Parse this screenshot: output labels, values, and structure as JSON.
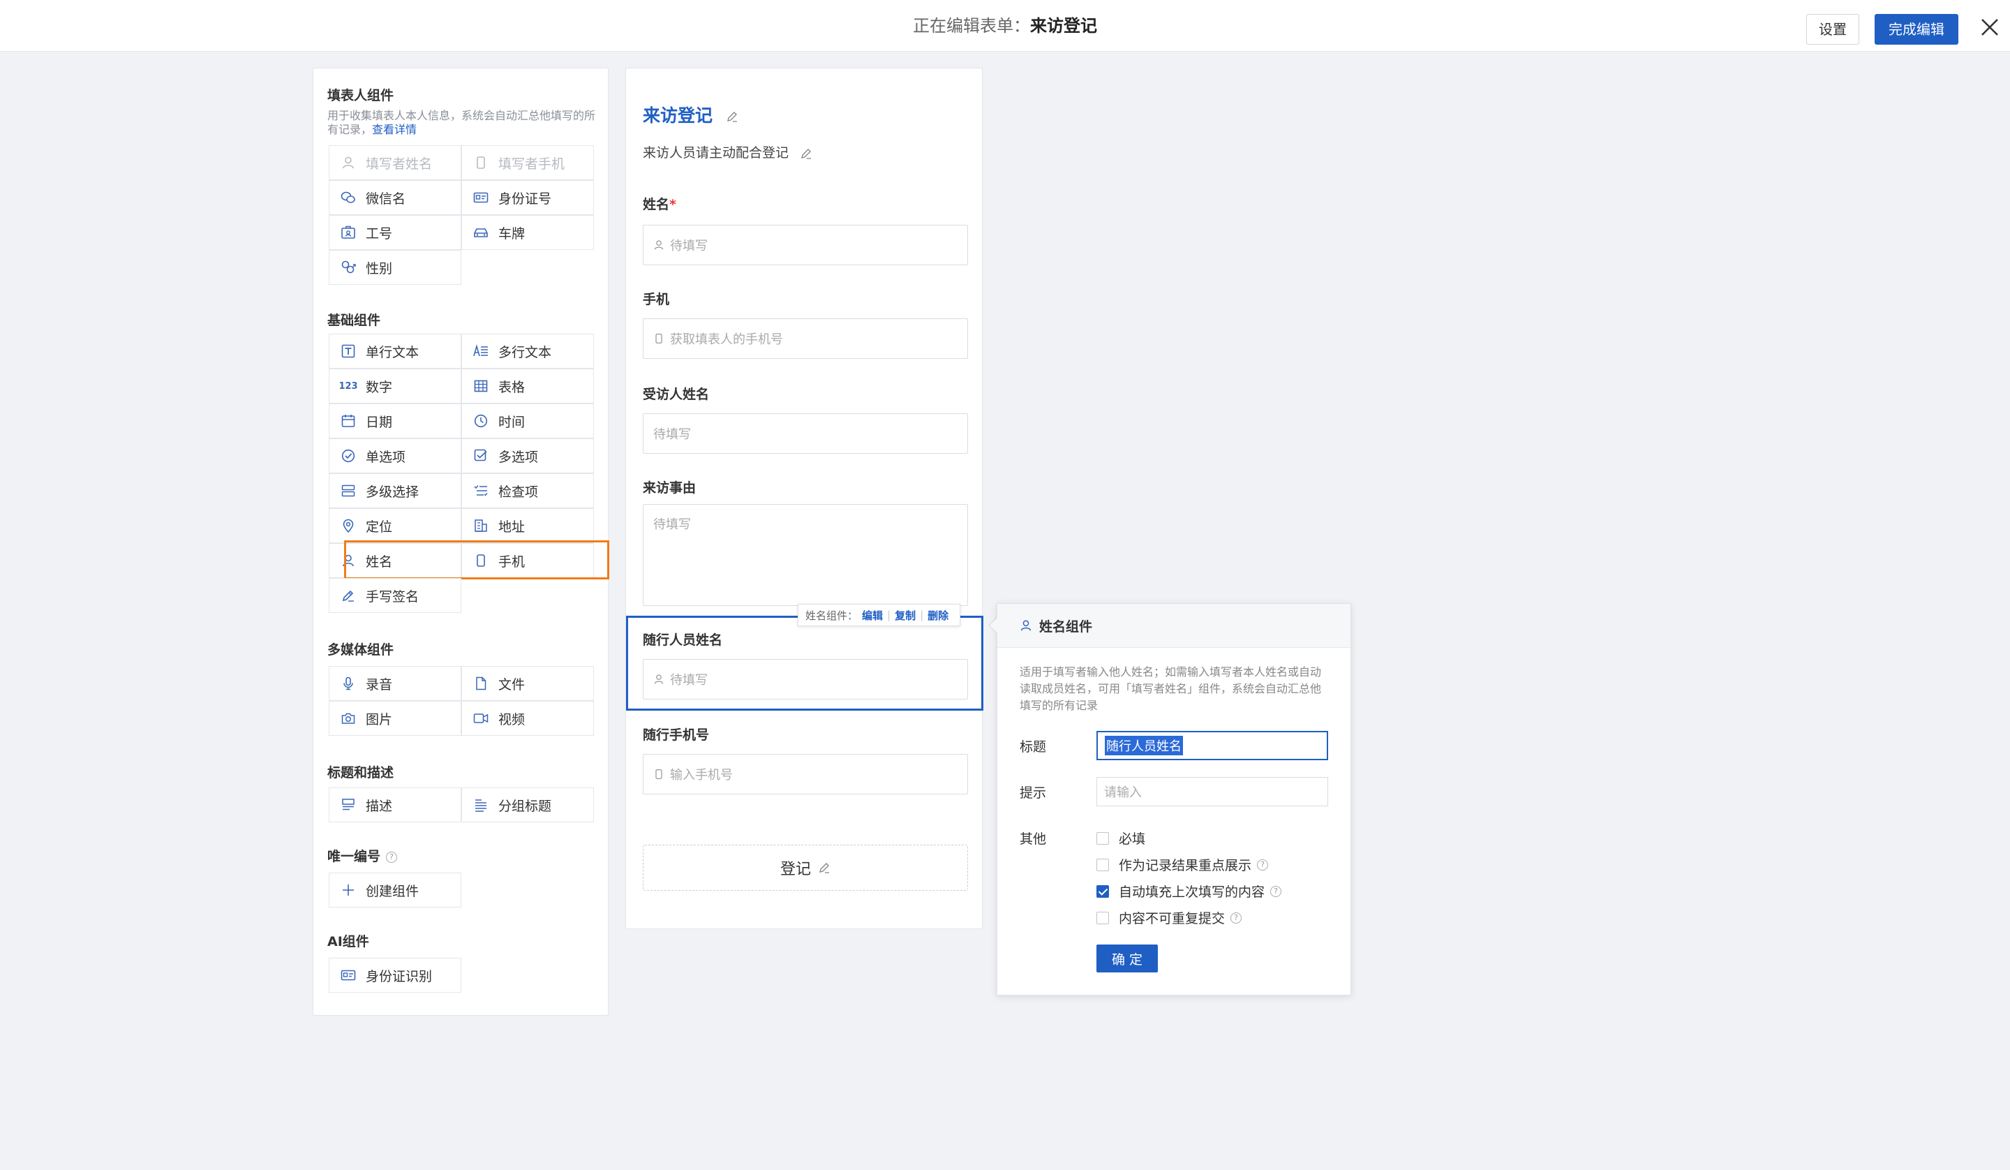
{
  "header": {
    "title_prefix": "正在编辑表单：",
    "title_name": "来访登记",
    "settings_label": "设置",
    "finish_label": "完成编辑"
  },
  "palette": {
    "filler_section": {
      "title": "填表人组件",
      "desc": "用于收集填表人本人信息，系统会自动汇总他填写的所有记录，",
      "desc_link": "查看详情",
      "items": [
        {
          "label": "填写者姓名",
          "icon": "user-icon",
          "disabled": true
        },
        {
          "label": "填写者手机",
          "icon": "phone-icon",
          "disabled": true
        },
        {
          "label": "微信名",
          "icon": "wechat-icon"
        },
        {
          "label": "身份证号",
          "icon": "id-card-icon"
        },
        {
          "label": "工号",
          "icon": "badge-icon"
        },
        {
          "label": "车牌",
          "icon": "car-icon"
        },
        {
          "label": "性别",
          "icon": "gender-icon"
        }
      ]
    },
    "basic_section": {
      "title": "基础组件",
      "items": [
        {
          "label": "单行文本",
          "icon": "text-icon"
        },
        {
          "label": "多行文本",
          "icon": "multiline-text-icon"
        },
        {
          "label": "数字",
          "icon": "number-icon"
        },
        {
          "label": "表格",
          "icon": "table-icon"
        },
        {
          "label": "日期",
          "icon": "calendar-icon"
        },
        {
          "label": "时间",
          "icon": "clock-icon"
        },
        {
          "label": "单选项",
          "icon": "radio-icon"
        },
        {
          "label": "多选项",
          "icon": "checkbox-icon"
        },
        {
          "label": "多级选择",
          "icon": "cascade-icon"
        },
        {
          "label": "检查项",
          "icon": "checklist-icon"
        },
        {
          "label": "定位",
          "icon": "location-icon"
        },
        {
          "label": "地址",
          "icon": "address-icon"
        },
        {
          "label": "姓名",
          "icon": "user-icon"
        },
        {
          "label": "手机",
          "icon": "phone-icon"
        },
        {
          "label": "手写签名",
          "icon": "signature-icon"
        }
      ]
    },
    "media_section": {
      "title": "多媒体组件",
      "items": [
        {
          "label": "录音",
          "icon": "microphone-icon"
        },
        {
          "label": "文件",
          "icon": "file-icon"
        },
        {
          "label": "图片",
          "icon": "camera-icon"
        },
        {
          "label": "视频",
          "icon": "video-icon"
        }
      ]
    },
    "heading_section": {
      "title": "标题和描述",
      "items": [
        {
          "label": "描述",
          "icon": "description-icon"
        },
        {
          "label": "分组标题",
          "icon": "group-title-icon"
        }
      ]
    },
    "unique_section": {
      "title": "唯一编号",
      "items": [
        {
          "label": "创建组件",
          "icon": "plus-icon"
        }
      ]
    },
    "ai_section": {
      "title": "AI组件",
      "items": [
        {
          "label": "身份证识别",
          "icon": "id-card-icon"
        }
      ]
    }
  },
  "form": {
    "title": "来访登记",
    "description": "来访人员请主动配合登记",
    "fields": [
      {
        "label": "姓名",
        "required": true,
        "placeholder": "待填写",
        "icon": "user-icon"
      },
      {
        "label": "手机",
        "placeholder": "获取填表人的手机号",
        "icon": "phone-icon"
      },
      {
        "label": "受访人姓名",
        "placeholder": "待填写"
      },
      {
        "label": "来访事由",
        "placeholder": "待填写"
      },
      {
        "label": "随行人员姓名",
        "placeholder": "待填写",
        "icon": "user-icon"
      },
      {
        "label": "随行手机号",
        "placeholder": "输入手机号",
        "icon": "phone-icon"
      }
    ],
    "submit_label": "登记",
    "toolbar": {
      "prefix": "姓名组件：",
      "edit": "编辑",
      "copy": "复制",
      "delete": "删除"
    }
  },
  "props": {
    "title": "姓名组件",
    "desc": "适用于填写者输入他人姓名；如需输入填写者本人姓名或自动读取成员姓名，可用「填写者姓名」组件，系统会自动汇总他填写的所有记录",
    "title_label": "标题",
    "title_value": "随行人员姓名",
    "hint_label": "提示",
    "hint_placeholder": "请输入",
    "other_label": "其他",
    "options": [
      {
        "label": "必填",
        "checked": false,
        "help": false
      },
      {
        "label": "作为记录结果重点展示",
        "checked": false,
        "help": true
      },
      {
        "label": "自动填充上次填写的内容",
        "checked": true,
        "help": true
      },
      {
        "label": "内容不可重复提交",
        "checked": false,
        "help": true
      }
    ],
    "ok_label": "确 定"
  },
  "colors": {
    "accent": "#1f5fc4",
    "highlight": "#f07c1a"
  }
}
